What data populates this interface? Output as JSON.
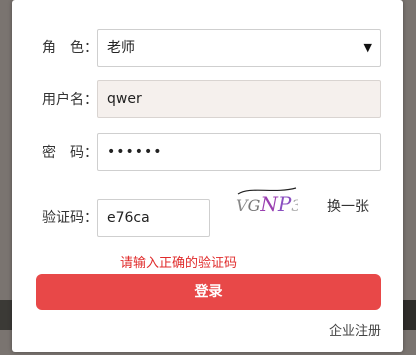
{
  "form": {
    "role": {
      "label": "角　色：",
      "value": "老师"
    },
    "username": {
      "label": "用户名：",
      "value": "qwer"
    },
    "password": {
      "label": "密　码：",
      "value": "••••••"
    },
    "captcha": {
      "label": "验证码：",
      "value": "e76ca",
      "image_text": "VGNP3",
      "refresh_label": "换一张"
    },
    "error_message": "请输入正确的验证码",
    "login_label": "登录",
    "register_label": "企业注册"
  },
  "colors": {
    "accent": "#e84848",
    "error": "#e02b2b",
    "autofill_bg": "#f5f0ed"
  }
}
